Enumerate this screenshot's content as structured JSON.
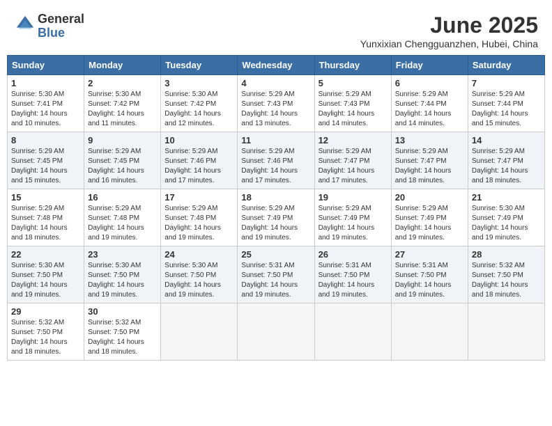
{
  "header": {
    "logo_general": "General",
    "logo_blue": "Blue",
    "month": "June 2025",
    "location": "Yunxixian Chengguanzhen, Hubei, China"
  },
  "weekdays": [
    "Sunday",
    "Monday",
    "Tuesday",
    "Wednesday",
    "Thursday",
    "Friday",
    "Saturday"
  ],
  "weeks": [
    [
      {
        "day": "1",
        "info": "Sunrise: 5:30 AM\nSunset: 7:41 PM\nDaylight: 14 hours\nand 10 minutes."
      },
      {
        "day": "2",
        "info": "Sunrise: 5:30 AM\nSunset: 7:42 PM\nDaylight: 14 hours\nand 11 minutes."
      },
      {
        "day": "3",
        "info": "Sunrise: 5:30 AM\nSunset: 7:42 PM\nDaylight: 14 hours\nand 12 minutes."
      },
      {
        "day": "4",
        "info": "Sunrise: 5:29 AM\nSunset: 7:43 PM\nDaylight: 14 hours\nand 13 minutes."
      },
      {
        "day": "5",
        "info": "Sunrise: 5:29 AM\nSunset: 7:43 PM\nDaylight: 14 hours\nand 14 minutes."
      },
      {
        "day": "6",
        "info": "Sunrise: 5:29 AM\nSunset: 7:44 PM\nDaylight: 14 hours\nand 14 minutes."
      },
      {
        "day": "7",
        "info": "Sunrise: 5:29 AM\nSunset: 7:44 PM\nDaylight: 14 hours\nand 15 minutes."
      }
    ],
    [
      {
        "day": "8",
        "info": "Sunrise: 5:29 AM\nSunset: 7:45 PM\nDaylight: 14 hours\nand 15 minutes."
      },
      {
        "day": "9",
        "info": "Sunrise: 5:29 AM\nSunset: 7:45 PM\nDaylight: 14 hours\nand 16 minutes."
      },
      {
        "day": "10",
        "info": "Sunrise: 5:29 AM\nSunset: 7:46 PM\nDaylight: 14 hours\nand 17 minutes."
      },
      {
        "day": "11",
        "info": "Sunrise: 5:29 AM\nSunset: 7:46 PM\nDaylight: 14 hours\nand 17 minutes."
      },
      {
        "day": "12",
        "info": "Sunrise: 5:29 AM\nSunset: 7:47 PM\nDaylight: 14 hours\nand 17 minutes."
      },
      {
        "day": "13",
        "info": "Sunrise: 5:29 AM\nSunset: 7:47 PM\nDaylight: 14 hours\nand 18 minutes."
      },
      {
        "day": "14",
        "info": "Sunrise: 5:29 AM\nSunset: 7:47 PM\nDaylight: 14 hours\nand 18 minutes."
      }
    ],
    [
      {
        "day": "15",
        "info": "Sunrise: 5:29 AM\nSunset: 7:48 PM\nDaylight: 14 hours\nand 18 minutes."
      },
      {
        "day": "16",
        "info": "Sunrise: 5:29 AM\nSunset: 7:48 PM\nDaylight: 14 hours\nand 19 minutes."
      },
      {
        "day": "17",
        "info": "Sunrise: 5:29 AM\nSunset: 7:48 PM\nDaylight: 14 hours\nand 19 minutes."
      },
      {
        "day": "18",
        "info": "Sunrise: 5:29 AM\nSunset: 7:49 PM\nDaylight: 14 hours\nand 19 minutes."
      },
      {
        "day": "19",
        "info": "Sunrise: 5:29 AM\nSunset: 7:49 PM\nDaylight: 14 hours\nand 19 minutes."
      },
      {
        "day": "20",
        "info": "Sunrise: 5:29 AM\nSunset: 7:49 PM\nDaylight: 14 hours\nand 19 minutes."
      },
      {
        "day": "21",
        "info": "Sunrise: 5:30 AM\nSunset: 7:49 PM\nDaylight: 14 hours\nand 19 minutes."
      }
    ],
    [
      {
        "day": "22",
        "info": "Sunrise: 5:30 AM\nSunset: 7:50 PM\nDaylight: 14 hours\nand 19 minutes."
      },
      {
        "day": "23",
        "info": "Sunrise: 5:30 AM\nSunset: 7:50 PM\nDaylight: 14 hours\nand 19 minutes."
      },
      {
        "day": "24",
        "info": "Sunrise: 5:30 AM\nSunset: 7:50 PM\nDaylight: 14 hours\nand 19 minutes."
      },
      {
        "day": "25",
        "info": "Sunrise: 5:31 AM\nSunset: 7:50 PM\nDaylight: 14 hours\nand 19 minutes."
      },
      {
        "day": "26",
        "info": "Sunrise: 5:31 AM\nSunset: 7:50 PM\nDaylight: 14 hours\nand 19 minutes."
      },
      {
        "day": "27",
        "info": "Sunrise: 5:31 AM\nSunset: 7:50 PM\nDaylight: 14 hours\nand 19 minutes."
      },
      {
        "day": "28",
        "info": "Sunrise: 5:32 AM\nSunset: 7:50 PM\nDaylight: 14 hours\nand 18 minutes."
      }
    ],
    [
      {
        "day": "29",
        "info": "Sunrise: 5:32 AM\nSunset: 7:50 PM\nDaylight: 14 hours\nand 18 minutes."
      },
      {
        "day": "30",
        "info": "Sunrise: 5:32 AM\nSunset: 7:50 PM\nDaylight: 14 hours\nand 18 minutes."
      },
      {
        "day": "",
        "info": ""
      },
      {
        "day": "",
        "info": ""
      },
      {
        "day": "",
        "info": ""
      },
      {
        "day": "",
        "info": ""
      },
      {
        "day": "",
        "info": ""
      }
    ]
  ]
}
